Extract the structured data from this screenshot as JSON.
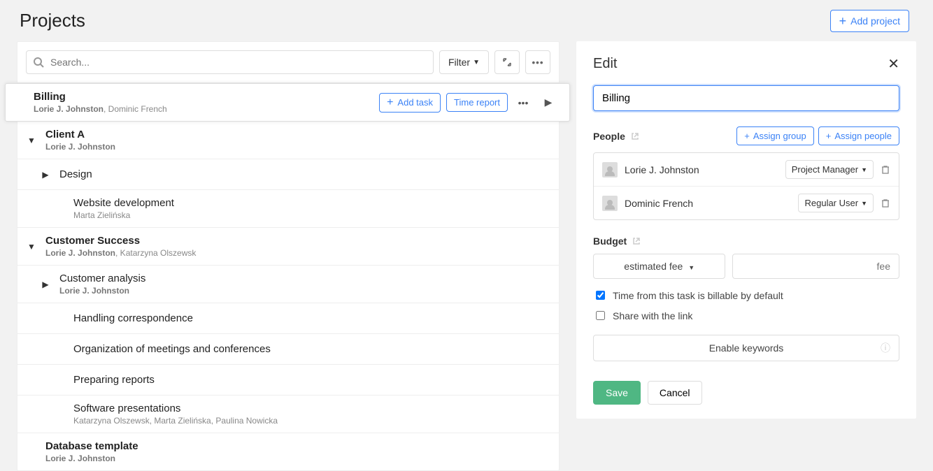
{
  "header": {
    "title": "Projects",
    "add_project_label": "Add project"
  },
  "toolbar": {
    "search_placeholder": "Search...",
    "filter_label": "Filter"
  },
  "tree": {
    "billing": {
      "title": "Billing",
      "owner": "Lorie J. Johnston",
      "extra": ", Dominic French",
      "add_task_label": "Add task",
      "time_report_label": "Time report"
    },
    "clientA": {
      "title": "Client A",
      "owner": "Lorie J. Johnston"
    },
    "design": {
      "title": "Design"
    },
    "webdev": {
      "title": "Website development",
      "sub": "Marta Zielińska"
    },
    "cs": {
      "title": "Customer Success",
      "owner": "Lorie J. Johnston",
      "extra": ", Katarzyna Olszewsk"
    },
    "analysis": {
      "title": "Customer analysis",
      "owner": "Lorie J. Johnston"
    },
    "corr": {
      "title": "Handling correspondence"
    },
    "org": {
      "title": "Organization of meetings and conferences"
    },
    "reports": {
      "title": "Preparing reports"
    },
    "software": {
      "title": "Software presentations",
      "sub": "Katarzyna Olszewsk, Marta Zielińska, Paulina Nowicka"
    },
    "db": {
      "title": "Database template",
      "owner": "Lorie J. Johnston"
    }
  },
  "edit": {
    "title": "Edit",
    "name_value": "Billing",
    "people_label": "People",
    "assign_group_label": "Assign group",
    "assign_people_label": "Assign people",
    "people": [
      {
        "name": "Lorie J. Johnston",
        "role": "Project Manager"
      },
      {
        "name": "Dominic French",
        "role": "Regular User"
      }
    ],
    "budget_label": "Budget",
    "estimated_fee_label": "estimated fee",
    "fee_placeholder": "fee",
    "billable_label": "Time from this task is billable by default",
    "share_label": "Share with the link",
    "keywords_label": "Enable keywords",
    "save_label": "Save",
    "cancel_label": "Cancel"
  }
}
